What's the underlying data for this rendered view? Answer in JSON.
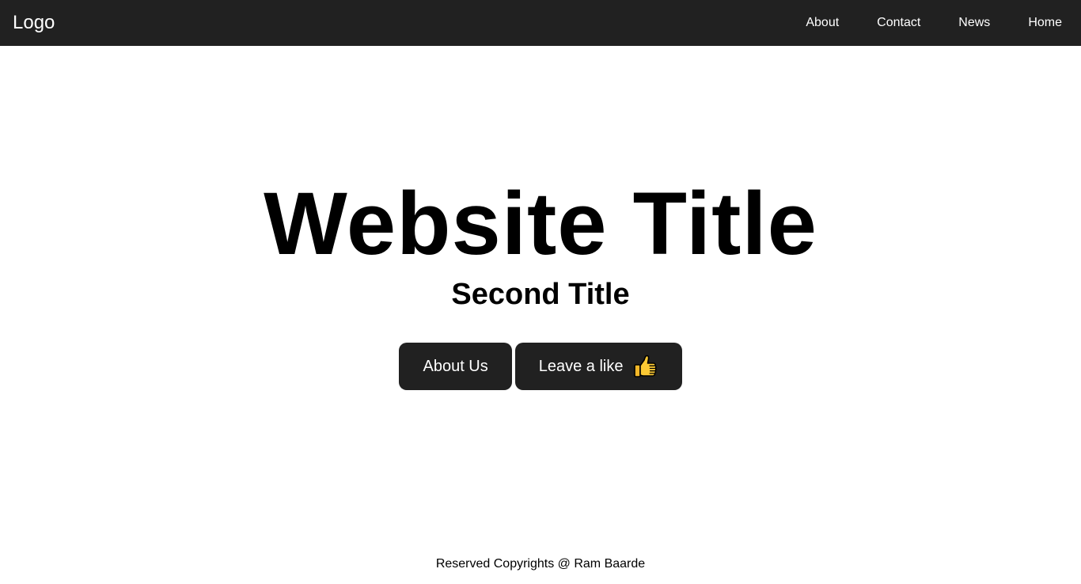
{
  "navbar": {
    "logo": "Logo",
    "links": [
      "About",
      "Contact",
      "News",
      "Home"
    ],
    "background": "#212121"
  },
  "hero": {
    "title": "Website Title",
    "subtitle": "Second Title",
    "buttons": {
      "about": "About Us",
      "like": "Leave a like",
      "like_icon": "thumbs-up-icon"
    }
  },
  "footer": {
    "text": "Reserved Copyrights @ Ram Baarde"
  }
}
